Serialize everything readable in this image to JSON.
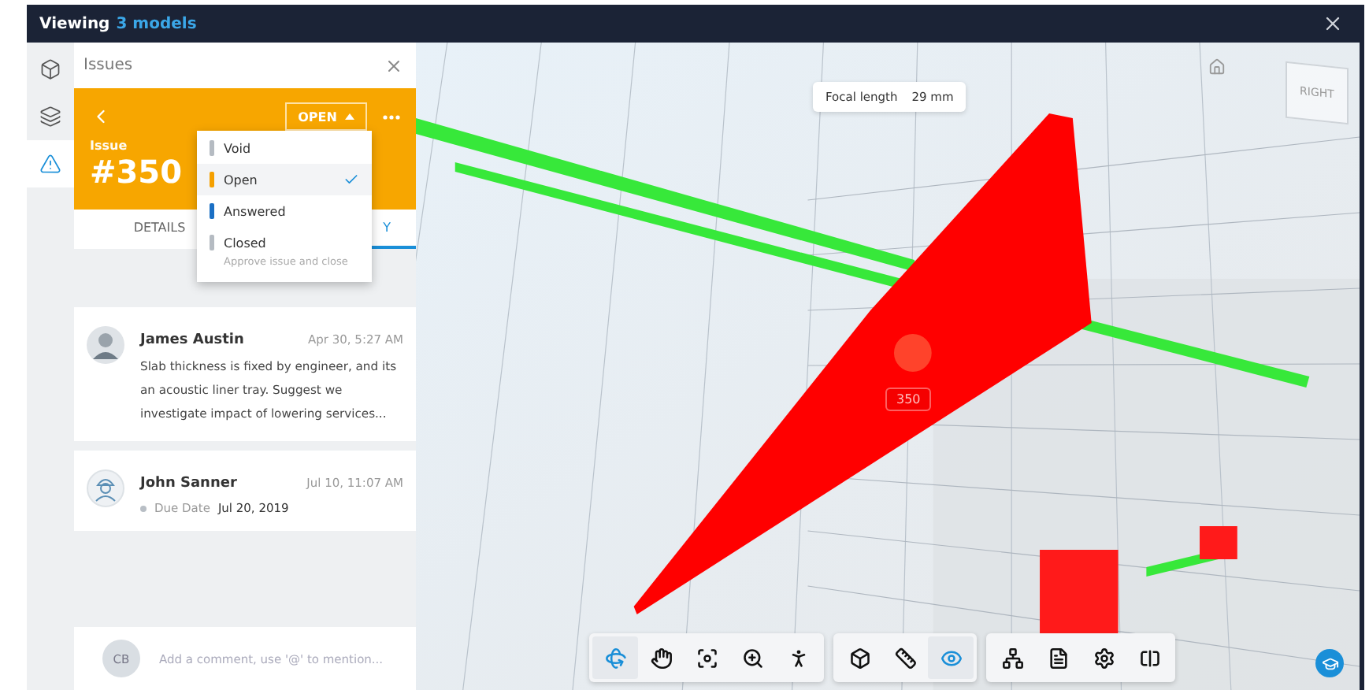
{
  "window": {
    "title": "Viewing",
    "models_link": "3 models"
  },
  "rail": [
    {
      "kind": "cube",
      "selected": false
    },
    {
      "kind": "layers",
      "selected": false
    },
    {
      "kind": "warning",
      "selected": true
    }
  ],
  "panel": {
    "title": "Issues",
    "status_button": "OPEN",
    "issue_label": "Issue",
    "issue_number": "#350",
    "tabs": [
      {
        "label": "DETAILS",
        "selected": false
      },
      {
        "label": "Y",
        "selected": true
      }
    ],
    "status_menu": [
      {
        "label": "Void",
        "color": "#b5bbc2",
        "selected": false
      },
      {
        "label": "Open",
        "color": "#f5a000",
        "selected": true
      },
      {
        "label": "Answered",
        "color": "#1a6fc4",
        "selected": false
      },
      {
        "label": "Closed",
        "color": "#b5bbc2",
        "selected": false,
        "hint": "Approve issue and close"
      }
    ],
    "activity": [
      {
        "kind": "comment",
        "author": "James Austin",
        "time": "Apr 30, 5:27 AM",
        "text": "Slab thickness is fixed by engineer, and its an acoustic liner tray. Suggest we investigate impact of lowering services..."
      },
      {
        "kind": "change",
        "author": "John Sanner",
        "time": "Jul 10, 11:07 AM",
        "field": "Due Date",
        "value": "Jul 20, 2019"
      }
    ],
    "comment_box": {
      "initials": "CB",
      "placeholder": "Add a comment, use '@' to mention..."
    }
  },
  "viewer": {
    "focal_label": "Focal length",
    "focal_value": "29 mm",
    "cube_face": "RIGHT",
    "pin_label": "350",
    "toolbar": [
      [
        {
          "kind": "orbit",
          "selected": true
        },
        {
          "kind": "pan",
          "selected": false
        },
        {
          "kind": "fit",
          "selected": false
        },
        {
          "kind": "zoom",
          "selected": false
        },
        {
          "kind": "walk",
          "selected": false
        }
      ],
      [
        {
          "kind": "explode",
          "selected": false
        },
        {
          "kind": "measure",
          "selected": false
        },
        {
          "kind": "visibility",
          "selected": true
        }
      ],
      [
        {
          "kind": "tree",
          "selected": false
        },
        {
          "kind": "properties",
          "selected": false
        },
        {
          "kind": "settings",
          "selected": false
        },
        {
          "kind": "fullscreen",
          "selected": false
        }
      ]
    ]
  }
}
